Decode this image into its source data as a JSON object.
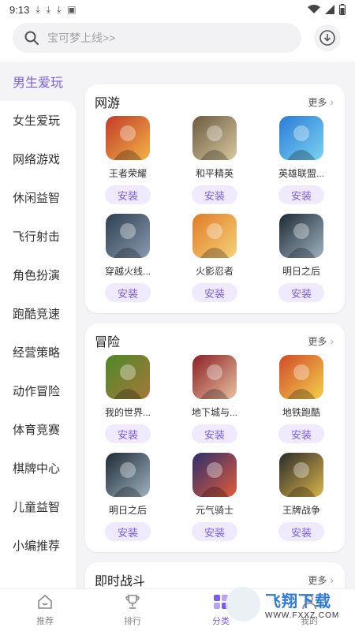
{
  "status_bar": {
    "time": "9:13"
  },
  "search": {
    "placeholder": "宝可梦上线>>"
  },
  "sidebar": {
    "items": [
      {
        "label": "男生爱玩",
        "active": true
      },
      {
        "label": "女生爱玩"
      },
      {
        "label": "网络游戏"
      },
      {
        "label": "休闲益智"
      },
      {
        "label": "飞行射击"
      },
      {
        "label": "角色扮演"
      },
      {
        "label": "跑酷竞速"
      },
      {
        "label": "经营策略"
      },
      {
        "label": "动作冒险"
      },
      {
        "label": "体育竞赛"
      },
      {
        "label": "棋牌中心"
      },
      {
        "label": "儿童益智"
      },
      {
        "label": "小编推荐"
      }
    ]
  },
  "sections": [
    {
      "title": "网游",
      "more": "更多",
      "games": [
        {
          "name": "王者荣耀",
          "install": "安装",
          "icon": "hero-icon",
          "colors": [
            "#c23a2a",
            "#f2b347"
          ]
        },
        {
          "name": "和平精英",
          "install": "安装",
          "icon": "soldier-icon",
          "colors": [
            "#6b5a3e",
            "#d8c9a0"
          ]
        },
        {
          "name": "英雄联盟...",
          "install": "安装",
          "icon": "heroine-icon",
          "colors": [
            "#2a7bd6",
            "#7ad3f2"
          ]
        },
        {
          "name": "穿越火线...",
          "install": "安装",
          "icon": "gunner-icon",
          "colors": [
            "#2c3e50",
            "#8a9bb0"
          ]
        },
        {
          "name": "火影忍者",
          "install": "安装",
          "icon": "ninja-icon",
          "colors": [
            "#e07b26",
            "#f6d27a"
          ]
        },
        {
          "name": "明日之后",
          "install": "安装",
          "icon": "survivor-icon",
          "colors": [
            "#1d2a36",
            "#9fb1bf"
          ]
        }
      ]
    },
    {
      "title": "冒险",
      "more": "更多",
      "games": [
        {
          "name": "我的世界...",
          "install": "安装",
          "icon": "block-icon",
          "colors": [
            "#4d8a2a",
            "#a7763a"
          ]
        },
        {
          "name": "地下城与...",
          "install": "安装",
          "icon": "swordsman-icon",
          "colors": [
            "#8a1f24",
            "#e9c2a0"
          ]
        },
        {
          "name": "地铁跑酷",
          "install": "安装",
          "icon": "runner-icon",
          "colors": [
            "#d24a2a",
            "#f2d04a"
          ]
        },
        {
          "name": "明日之后",
          "install": "安装",
          "icon": "survivor-icon",
          "colors": [
            "#1d2a36",
            "#9fb1bf"
          ]
        },
        {
          "name": "元气骑士",
          "install": "安装",
          "icon": "knight-icon",
          "colors": [
            "#2a2f6b",
            "#e25b3a"
          ]
        },
        {
          "name": "王牌战争",
          "install": "安装",
          "icon": "warrior-icon",
          "colors": [
            "#2a2a2a",
            "#d9b44a"
          ]
        }
      ]
    },
    {
      "title": "即时战斗",
      "more": "更多",
      "games": []
    }
  ],
  "bottom_nav": {
    "items": [
      {
        "label": "推荐"
      },
      {
        "label": "排行"
      },
      {
        "label": "分类",
        "active": true
      },
      {
        "label": "我的"
      }
    ]
  },
  "watermark": {
    "main": "飞翔下载",
    "sub": "WWW.FXXZ.COM"
  },
  "colors": {
    "accent": "#7c5ce6",
    "install_bg": "#efeafd"
  }
}
